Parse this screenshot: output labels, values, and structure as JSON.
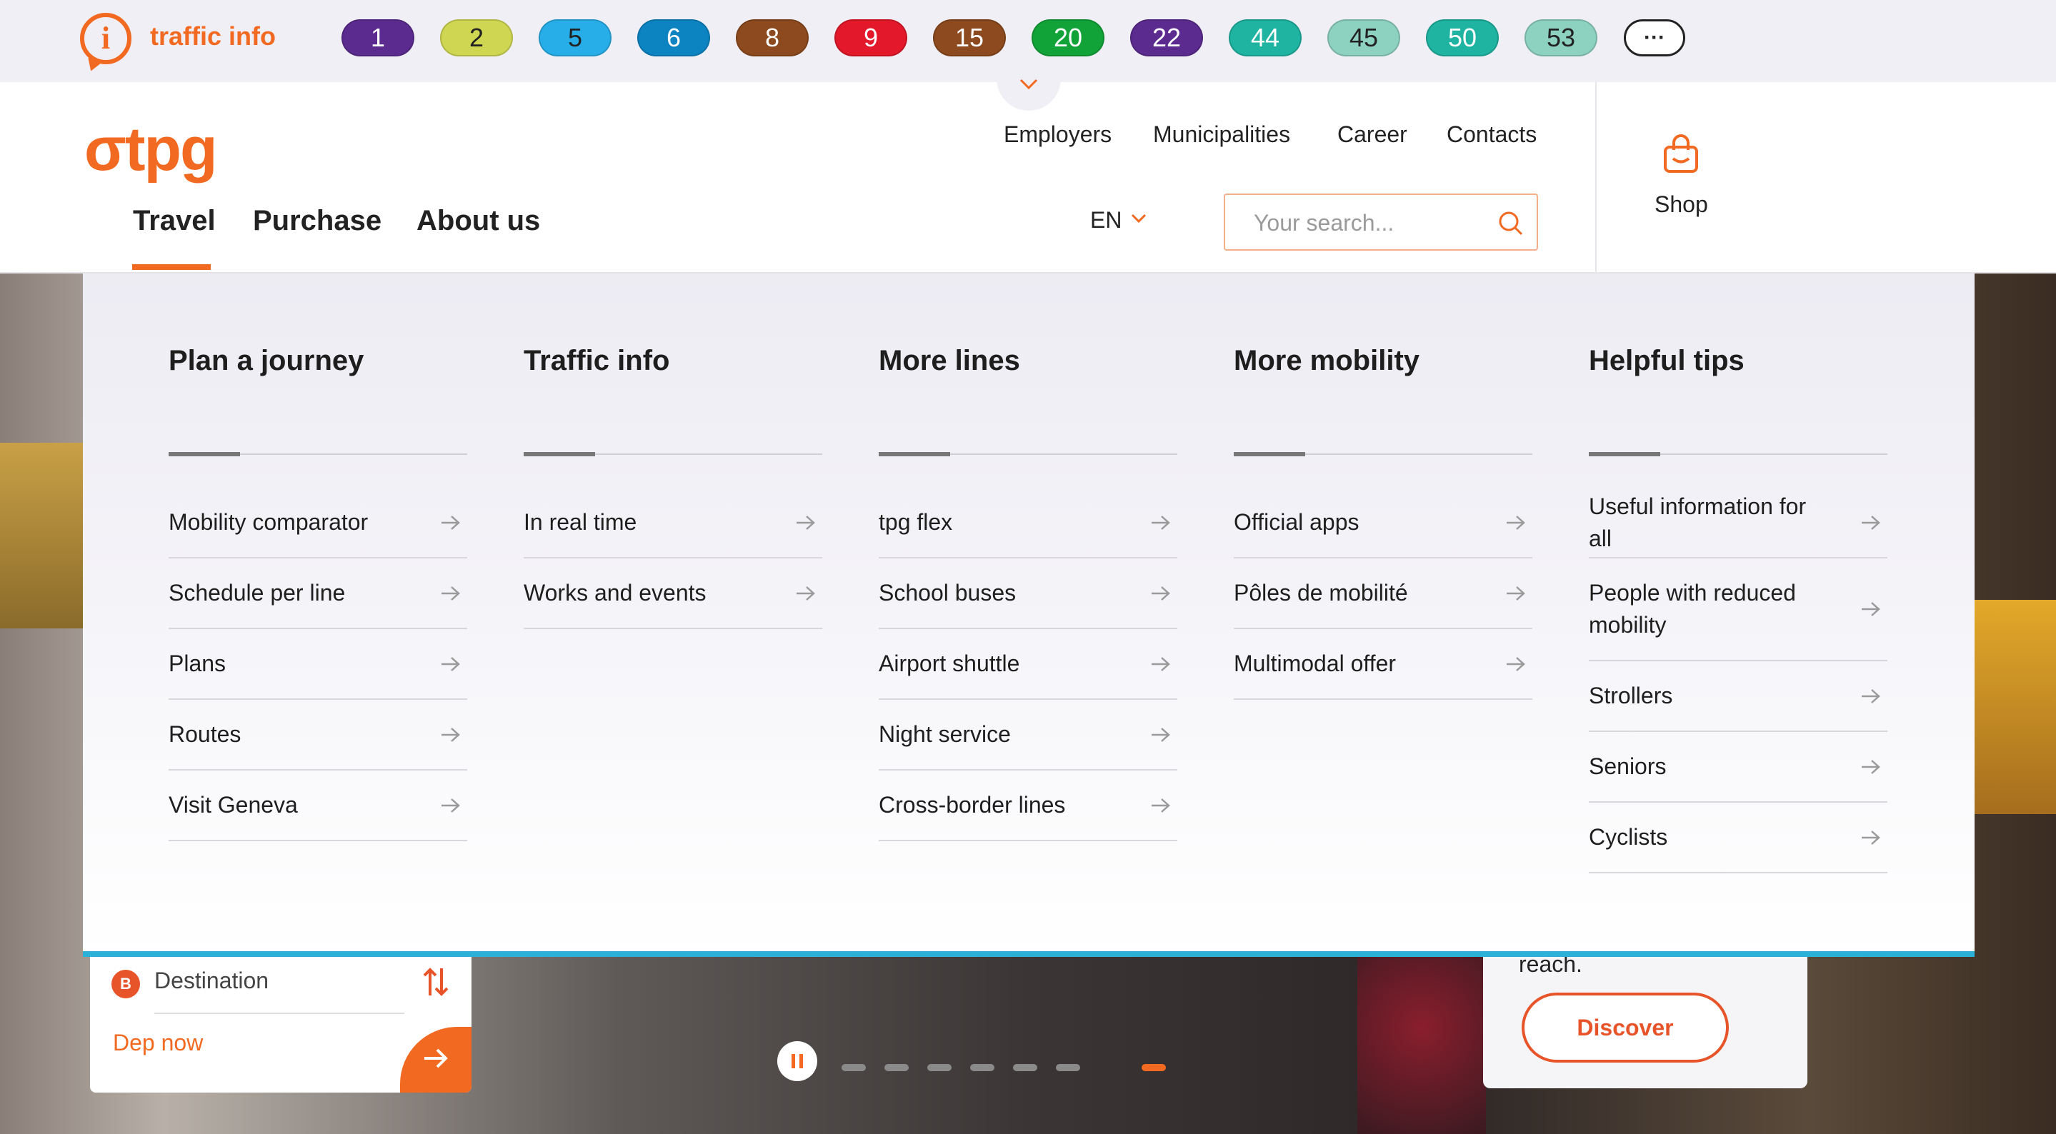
{
  "traffic_info": {
    "label": "traffic info",
    "icon": "info-icon"
  },
  "lines": [
    {
      "label": "1",
      "color": "#5b2b8f",
      "text_color": "#ffffff"
    },
    {
      "label": "2",
      "color": "#cfd651",
      "text_color": "#222222"
    },
    {
      "label": "5",
      "color": "#27aee8",
      "text_color": "#222222"
    },
    {
      "label": "6",
      "color": "#0c84c2",
      "text_color": "#ffffff"
    },
    {
      "label": "8",
      "color": "#8c4a1e",
      "text_color": "#ffffff"
    },
    {
      "label": "9",
      "color": "#e3182a",
      "text_color": "#ffffff"
    },
    {
      "label": "15",
      "color": "#8c4a1e",
      "text_color": "#ffffff"
    },
    {
      "label": "20",
      "color": "#12a338",
      "text_color": "#ffffff"
    },
    {
      "label": "22",
      "color": "#5b2b8f",
      "text_color": "#ffffff"
    },
    {
      "label": "44",
      "color": "#1fb3a1",
      "text_color": "#ffffff"
    },
    {
      "label": "45",
      "color": "#8dd1c0",
      "text_color": "#222222"
    },
    {
      "label": "50",
      "color": "#1fb3a1",
      "text_color": "#ffffff"
    },
    {
      "label": "53",
      "color": "#8dd1c0",
      "text_color": "#222222"
    }
  ],
  "more_lines": {
    "label": "···"
  },
  "brand": {
    "logo_text": "σtpg",
    "accent": "#f26a21"
  },
  "utility_nav": [
    "Employers",
    "Municipalities",
    "Career",
    "Contacts"
  ],
  "main_nav": {
    "items": [
      "Travel",
      "Purchase",
      "About us"
    ],
    "active": "Travel"
  },
  "language": {
    "selected": "EN"
  },
  "search": {
    "placeholder": "Your search...",
    "value": ""
  },
  "shop": {
    "label": "Shop",
    "icon": "shopping-bag-icon"
  },
  "mega_menu": {
    "columns": [
      {
        "title": "Plan a journey",
        "items": [
          "Mobility comparator",
          "Schedule per line",
          "Plans",
          "Routes",
          "Visit Geneva"
        ]
      },
      {
        "title": "Traffic info",
        "items": [
          "In real time",
          "Works and events"
        ]
      },
      {
        "title": "More lines",
        "items": [
          "tpg flex",
          "School buses",
          "Airport shuttle",
          "Night service",
          "Cross-border lines"
        ]
      },
      {
        "title": "More mobility",
        "items": [
          "Official apps",
          "Pôles de mobilité",
          "Multimodal offer"
        ]
      },
      {
        "title": "Helpful tips",
        "items": [
          "Useful information for all",
          "People with reduced mobility",
          "Strollers",
          "Seniors",
          "Cyclists"
        ]
      }
    ]
  },
  "journey_widget": {
    "badge": "B",
    "destination_label": "Destination",
    "departure": "Dep now"
  },
  "carousel": {
    "slide_count": 7,
    "active_index": 6
  },
  "hero_card": {
    "text": "reach.",
    "button": "Discover"
  }
}
